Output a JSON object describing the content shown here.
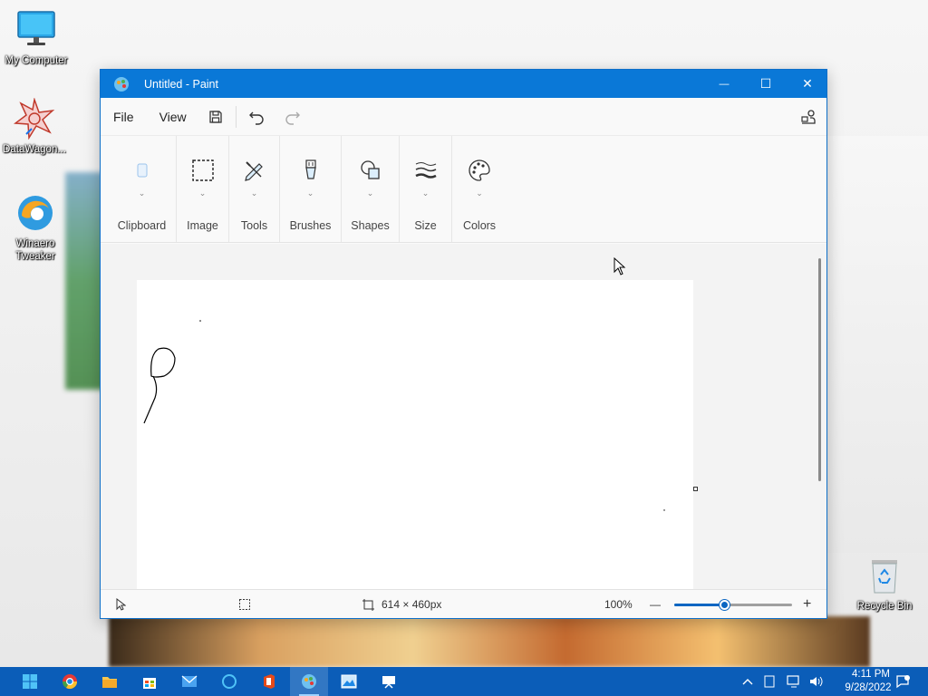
{
  "desktop": {
    "icons": [
      {
        "label": "My Computer",
        "icon": "monitor-icon"
      },
      {
        "label": "DataWagon...",
        "icon": "star-logo-icon"
      },
      {
        "label": "Winaero Tweaker",
        "icon": "edge-like-icon"
      },
      {
        "label": "Recycle Bin",
        "icon": "recycle-bin-icon"
      }
    ]
  },
  "window": {
    "title": "Untitled - Paint",
    "controls": {
      "minimize": "—",
      "maximize": "☐",
      "close": "✕"
    }
  },
  "menubar": {
    "file": "File",
    "view": "View"
  },
  "ribbon": {
    "groups": [
      {
        "label": "Clipboard",
        "icon": "clipboard-icon"
      },
      {
        "label": "Image",
        "icon": "select-rectangle-icon"
      },
      {
        "label": "Tools",
        "icon": "pencil-icon"
      },
      {
        "label": "Brushes",
        "icon": "brush-icon"
      },
      {
        "label": "Shapes",
        "icon": "shapes-icon"
      },
      {
        "label": "Size",
        "icon": "stroke-size-icon"
      },
      {
        "label": "Colors",
        "icon": "palette-icon"
      }
    ]
  },
  "status": {
    "canvas_size": "614 × 460px",
    "zoom": "100%",
    "zoom_minus": "—",
    "zoom_plus": "+",
    "zoom_level": 0.42
  },
  "taskbar": {
    "time": "4:11 PM",
    "date": "9/28/2022"
  },
  "colors": {
    "titlebar": "#0a78d7",
    "taskbar": "#0b5db8",
    "accent": "#0a66c2"
  }
}
